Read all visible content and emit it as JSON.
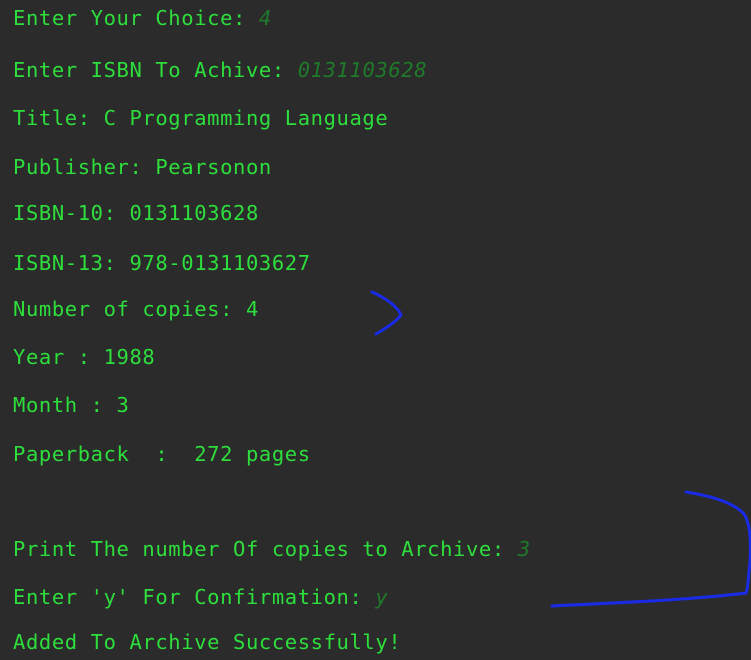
{
  "terminal": {
    "lines": [
      {
        "label": "Enter Your Choice: ",
        "input": "4"
      },
      {
        "label": "Enter ISBN To Achive: ",
        "input": "0131103628"
      },
      {
        "text": "Title: C Programming Language"
      },
      {
        "text": "Publisher: Pearsonon"
      },
      {
        "text": "ISBN-10: 0131103628"
      },
      {
        "text": "ISBN-13: 978-0131103627"
      },
      {
        "text": "Number of copies: 4"
      },
      {
        "text": "Year : 1988"
      },
      {
        "text": "Month : 3"
      },
      {
        "text": "Paperback  :  272 pages"
      },
      {
        "label": "Print The number Of copies to Archive: ",
        "input": "3"
      },
      {
        "label": "Enter 'y' For Confirmation: ",
        "input": "y"
      },
      {
        "text": "Added To Archive Successfully!"
      }
    ]
  },
  "colors": {
    "background": "#2b2b2b",
    "text": "#2dde3c",
    "user_input": "#1f7a2a",
    "annotation": "#1a2be8"
  }
}
